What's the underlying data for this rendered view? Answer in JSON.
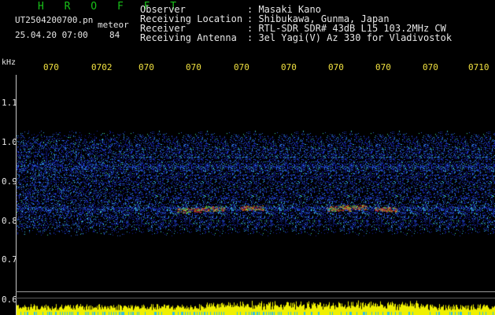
{
  "header": {
    "app_title": "H R O F F T",
    "filename": "UT2504200700.pn",
    "label_meteor": "meteor",
    "datetime": "25.04.20 07:00",
    "count": "84"
  },
  "info": {
    "observer_key": "Observer",
    "observer_val": ": Masaki Kano",
    "location_key": "Receiving Location",
    "location_val": ": Shibukawa, Gunma, Japan",
    "receiver_key": "Receiver",
    "receiver_val": ": RTL-SDR SDR# 43dB L15 103.2MHz CW",
    "antenna_key": "Receiving Antenna",
    "antenna_val": ": 3el Yagi(V) Az 330 for Vladivostok"
  },
  "axis": {
    "y_unit": "kHz",
    "y_labels": [
      "1.1",
      "1.0",
      "0.9",
      "0.8",
      "0.7",
      "0.6"
    ],
    "x_labels": [
      "070",
      "0702",
      "070",
      "070",
      "070",
      "070",
      "070",
      "070",
      "070",
      "0710"
    ],
    "ylim": [
      0.6,
      1.2
    ]
  },
  "colors": {
    "background": "#000000",
    "signal_band": "#1020c0",
    "signal_peak": "#e02020",
    "level_bars": "#f0f000"
  }
}
